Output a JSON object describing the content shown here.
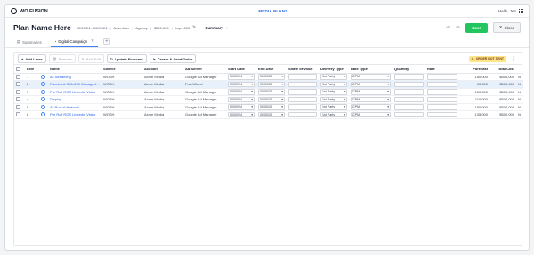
{
  "app": {
    "brand": "WO FUSION",
    "section": "MEDIA PLANS",
    "user": "Hello, Jen"
  },
  "plan": {
    "title": "Plan Name Here",
    "dates": "00/00/24 - 00/00/24",
    "advertiser": "Advertiser",
    "agency": "Agency",
    "budget": "$000,000",
    "impressions": "Imps 000",
    "view": "Summary",
    "save_label": "Save",
    "close_label": "Close"
  },
  "tabs": [
    {
      "label": "Summaries"
    },
    {
      "label": "Digital Campaign"
    }
  ],
  "toolbar": {
    "add_lines": "Add Lines",
    "remove": "Remove",
    "bulk_edit": "Bulk Edit",
    "update_forecast": "Update Forecast",
    "create_send": "Create & Send Order",
    "warning": "ORDER NOT SENT"
  },
  "table": {
    "headers": {
      "line": "Line",
      "name": "Name",
      "source": "Source",
      "account": "Account",
      "ad_server": "Ad Server",
      "start_date": "Start Date",
      "end_date": "End Date",
      "share_of_voice": "Share of Voice",
      "delivery_type": "Delivery Type",
      "rate_type": "Rate Type",
      "quantity": "Quantity",
      "rate": "Rate",
      "forecast": "Forecast",
      "total_cost": "Total Cost"
    },
    "rows": [
      {
        "line": "1",
        "name": "All Streaming",
        "source": "WOSH",
        "account": "Acme Media",
        "ad_server": "Google Ad Manager",
        "start": "00/00/24",
        "end": "00/00/24",
        "delivery": "1st Party",
        "rate_type": "CPM",
        "forecast": "150,000",
        "total": "$500,000",
        "flag": "N"
      },
      {
        "line": "2",
        "name": "Facebook 300x250 Managed S...",
        "source": "WOSH",
        "account": "Acme Media",
        "ad_server": "FreeWheel",
        "start": "00/00/24",
        "end": "00/00/24",
        "delivery": "1st Party",
        "rate_type": "CPM",
        "forecast": "90,000",
        "total": "$500,000",
        "flag": "N"
      },
      {
        "line": "3",
        "name": "Pre Roll ROS Linkedin Video",
        "source": "WOSH",
        "account": "Acme Media",
        "ad_server": "Google Ad Manager",
        "start": "00/00/24",
        "end": "00/00/24",
        "delivery": "1st Party",
        "rate_type": "CPM",
        "forecast": "150,000",
        "total": "$500,000",
        "flag": "N"
      },
      {
        "line": "4",
        "name": "Display",
        "source": "WOSH",
        "account": "Acme Media",
        "ad_server": "Google Ad Manager",
        "start": "00/00/24",
        "end": "00/00/24",
        "delivery": "1st Party",
        "rate_type": "CPM",
        "forecast": "110,000",
        "total": "$500,000",
        "flag": "N"
      },
      {
        "line": "5",
        "name": "All Run of Network",
        "source": "WOSH",
        "account": "Acme Media",
        "ad_server": "Google Ad Manager",
        "start": "00/00/24",
        "end": "00/00/24",
        "delivery": "1st Party",
        "rate_type": "CPM",
        "forecast": "150,000",
        "total": "$500,000",
        "flag": "N"
      },
      {
        "line": "6",
        "name": "Pre Roll ROS Linkedin Video",
        "source": "WOSH",
        "account": "Acme Media",
        "ad_server": "Google Ad Manager",
        "start": "00/00/24",
        "end": "00/00/24",
        "delivery": "1st Party",
        "rate_type": "CPM",
        "forecast": "135,000",
        "total": "$500,000",
        "flag": "N"
      }
    ]
  }
}
